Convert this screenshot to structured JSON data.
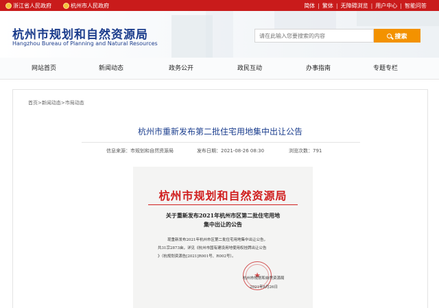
{
  "topbar": {
    "gov_zhejiang": "浙江省人民政府",
    "gov_hangzhou": "杭州市人民政府",
    "links": [
      "简体",
      "繁体",
      "无障碍浏览",
      "用户中心",
      "智能问答"
    ]
  },
  "header": {
    "title": "杭州市规划和自然资源局",
    "subtitle": "Hangzhou Bureau of Planning and Natural Resources"
  },
  "search": {
    "placeholder": "请在此输入您要搜索的内容",
    "button_label": "搜索"
  },
  "nav": {
    "items": [
      "网站首页",
      "新闻动态",
      "政务公开",
      "政民互动",
      "办事指南",
      "专题专栏"
    ]
  },
  "breadcrumb": "首页>新闻动态>市局动态",
  "article": {
    "title": "杭州市重新发布第二批住宅用地集中出让公告",
    "source_label": "信息来源：",
    "source": "市规划和自然资源局",
    "date_label": "发布日期：",
    "date": "2021-08-26 08:30",
    "views_label": "浏览次数：",
    "views": "791"
  },
  "document": {
    "org": "杭州市规划和自然资源局",
    "title_line1": "关于重新发布2021年杭州市区第二批住宅用地",
    "title_line2": "集中出让的公告",
    "body_line1": "现重新发布2021年杭州市区第二批住宅用地集中出让公告，",
    "body_line2": "共31宗2873亩，详见《杭州市国有建设用地使用权挂牌出让公告",
    "body_line3": "》（杭规划资源告[2021]R001号、R002号）。",
    "sign_org": "杭州市规划和自然资源局",
    "sign_date": "2021年8月26日"
  },
  "colors": {
    "topbar": "#c91b1b",
    "brand_blue": "#1b3c8c",
    "search_button": "#f39200",
    "doc_red": "#d01e1e"
  }
}
